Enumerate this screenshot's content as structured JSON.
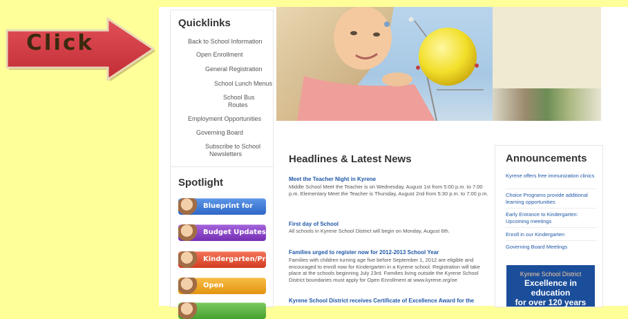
{
  "arrow": {
    "label": "Click",
    "color": "#d23c43"
  },
  "quicklinks": {
    "title": "Quicklinks",
    "items": [
      "Back to School Information",
      "Open Enrollment",
      "General Registration",
      "School Lunch Menus",
      "School Bus",
      "Routes",
      "Employment Opportunities",
      "Governing Board",
      "Subscribe to School",
      "Newsletters"
    ]
  },
  "spotlight": {
    "title": "Spotlight",
    "buttons": [
      {
        "label": "Blueprint for Kyrene",
        "color": "#3a79d6"
      },
      {
        "label": "Budget Updates",
        "color": "#8a3fc6"
      },
      {
        "label": "Kindergarten/Preschool",
        "color": "#e94f33"
      },
      {
        "label": "Open Enrollment",
        "color": "#f0a418"
      },
      {
        "label": "",
        "color": "#56b43c"
      }
    ]
  },
  "headlines": {
    "title": "Headlines & Latest News",
    "items": [
      {
        "head": "Meet the Teacher Night in Kyrene",
        "body": "Middle School Meet the Teacher is on Wednesday, August 1st from 5:00 p.m. to 7:00 p.m. Elementary Meet the Teacher is Thursday, August 2nd from 5:30 p.m. to 7:00 p.m."
      },
      {
        "head": "First day of School",
        "body": "All schools in Kyrene School District will begin on Monday, August 6th."
      },
      {
        "head": "Families urged to register now for 2012-2013 School Year",
        "body": "Families with children turning age five before September 1, 2012 are eligible and encouraged to enroll now for Kindergarten in a Kyrene school. Registration will take place at the schools beginning July 23rd. Families living outside the Kyrene School District boundaries must apply for Open Enrollment at www.kyrene.org/oe"
      },
      {
        "head": "Kyrene School District receives Certificate of Excellence Award for the",
        "body": ""
      }
    ]
  },
  "announcements": {
    "title": "Announcements",
    "items": [
      "Kyrene offers free immunization clinics",
      "Choice Programs provide additional learning opportunities",
      "Early Entrance to Kindergarten: Upcoming meetings",
      "Enroll in our Kindergarten",
      "Governing Board Meetings"
    ],
    "badge": {
      "line1": "Kyrene School District",
      "line2": "Excellence in education",
      "line3": "for over 120 years"
    }
  }
}
